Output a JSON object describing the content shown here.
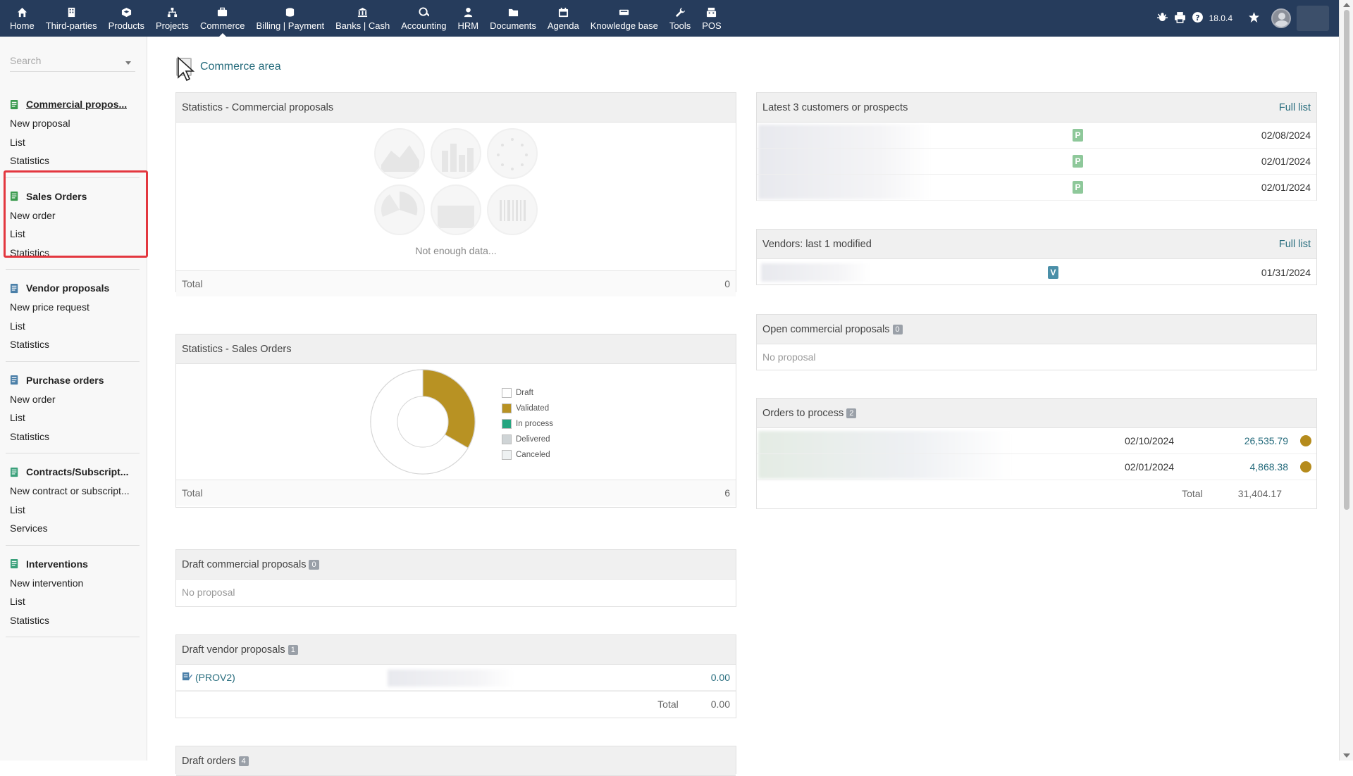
{
  "topnav": {
    "items": [
      {
        "label": "Home",
        "icon": "home-icon"
      },
      {
        "label": "Third-parties",
        "icon": "building-icon"
      },
      {
        "label": "Products",
        "icon": "cube-icon"
      },
      {
        "label": "Projects",
        "icon": "sitemap-icon"
      },
      {
        "label": "Commerce",
        "icon": "suitcase-icon"
      },
      {
        "label": "Billing | Payment",
        "icon": "coins-icon"
      },
      {
        "label": "Banks | Cash",
        "icon": "bank-icon"
      },
      {
        "label": "Accounting",
        "icon": "search-dollar-icon"
      },
      {
        "label": "HRM",
        "icon": "user-tie-icon"
      },
      {
        "label": "Documents",
        "icon": "folder-icon"
      },
      {
        "label": "Agenda",
        "icon": "calendar-icon"
      },
      {
        "label": "Knowledge base",
        "icon": "ticket-icon"
      },
      {
        "label": "Tools",
        "icon": "wrench-icon"
      },
      {
        "label": "POS",
        "icon": "cash-register-icon"
      }
    ],
    "active": "Commerce",
    "version": "18.0.4"
  },
  "sidebar": {
    "search_placeholder": "Search",
    "sections": [
      {
        "title": "Commercial propos...",
        "links": [
          "New proposal",
          "List",
          "Statistics"
        ]
      },
      {
        "title": "Sales Orders",
        "links": [
          "New order",
          "List",
          "Statistics"
        ]
      },
      {
        "title": "Vendor proposals",
        "links": [
          "New price request",
          "List",
          "Statistics"
        ]
      },
      {
        "title": "Purchase orders",
        "links": [
          "New order",
          "List",
          "Statistics"
        ]
      },
      {
        "title": "Contracts/Subscript...",
        "links": [
          "New contract or subscript...",
          "List",
          "Services"
        ]
      },
      {
        "title": "Interventions",
        "links": [
          "New intervention",
          "List",
          "Statistics"
        ]
      }
    ]
  },
  "page": {
    "title": "Commerce area"
  },
  "stats_proposals": {
    "title": "Statistics - Commercial proposals",
    "empty_text": "Not enough data...",
    "total_label": "Total",
    "total_value": "0"
  },
  "stats_orders": {
    "title": "Statistics - Sales Orders",
    "total_label": "Total",
    "total_value": "6",
    "legend": [
      {
        "label": "Draft",
        "color": "#ffffff"
      },
      {
        "label": "Validated",
        "color": "#b89223"
      },
      {
        "label": "In process",
        "color": "#25a580"
      },
      {
        "label": "Delivered",
        "color": "#cfd4d6"
      },
      {
        "label": "Canceled",
        "color": "#eef1f2"
      }
    ]
  },
  "chart_data": {
    "type": "pie",
    "title": "Statistics - Sales Orders",
    "categories": [
      "Draft",
      "Validated",
      "In process",
      "Delivered",
      "Canceled"
    ],
    "values": [
      4,
      2,
      0,
      0,
      0
    ],
    "colors": [
      "#ffffff",
      "#b89223",
      "#25a580",
      "#cfd4d6",
      "#eef1f2"
    ]
  },
  "draft_proposals": {
    "title": "Draft commercial proposals",
    "count": "0",
    "empty_text": "No proposal"
  },
  "draft_vendor": {
    "title": "Draft vendor proposals",
    "count": "1",
    "ref": "(PROV2)",
    "amount": "0.00",
    "total_label": "Total",
    "total_value": "0.00"
  },
  "draft_orders": {
    "title": "Draft orders",
    "count": "4"
  },
  "latest_customers": {
    "title": "Latest 3 customers or prospects",
    "link": "Full list",
    "rows": [
      {
        "tag": "P",
        "date": "02/08/2024"
      },
      {
        "tag": "P",
        "date": "02/01/2024"
      },
      {
        "tag": "P",
        "date": "02/01/2024"
      }
    ],
    "tag_color": "#8ec89a"
  },
  "vendors": {
    "title": "Vendors: last 1 modified",
    "link": "Full list",
    "rows": [
      {
        "tag": "V",
        "date": "01/31/2024"
      }
    ],
    "tag_color": "#4a8fa8"
  },
  "open_proposals": {
    "title": "Open commercial proposals",
    "count": "0",
    "empty_text": "No proposal"
  },
  "orders_process": {
    "title": "Orders to process",
    "count": "2",
    "rows": [
      {
        "date": "02/10/2024",
        "amount": "26,535.79"
      },
      {
        "date": "02/01/2024",
        "amount": "4,868.38"
      }
    ],
    "total_label": "Total",
    "total_value": "31,404.17",
    "status_color": "#b58b1c"
  }
}
